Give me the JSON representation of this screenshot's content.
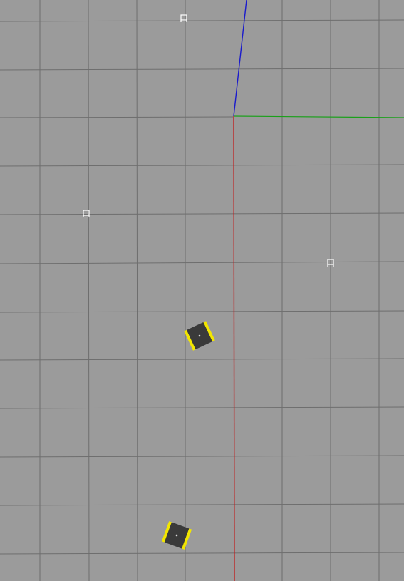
{
  "scene": {
    "background_color": "#9b9b9b",
    "grid_color": "#6e6e6e",
    "axes": {
      "x_axis_color": "#c02020",
      "y_axis_color": "#1aa01a",
      "z_axis_color": "#1a1acc"
    },
    "markers": [
      {
        "name": "waypoint-marker",
        "icon": "waypoint-icon"
      },
      {
        "name": "waypoint-marker",
        "icon": "waypoint-icon"
      },
      {
        "name": "waypoint-marker",
        "icon": "waypoint-icon"
      }
    ],
    "robots": [
      {
        "name": "robot",
        "icon": "robot-icon",
        "body_color": "#3a3a3a",
        "wheel_color": "#f2e600"
      },
      {
        "name": "robot",
        "icon": "robot-icon",
        "body_color": "#3a3a3a",
        "wheel_color": "#f2e600"
      }
    ]
  }
}
